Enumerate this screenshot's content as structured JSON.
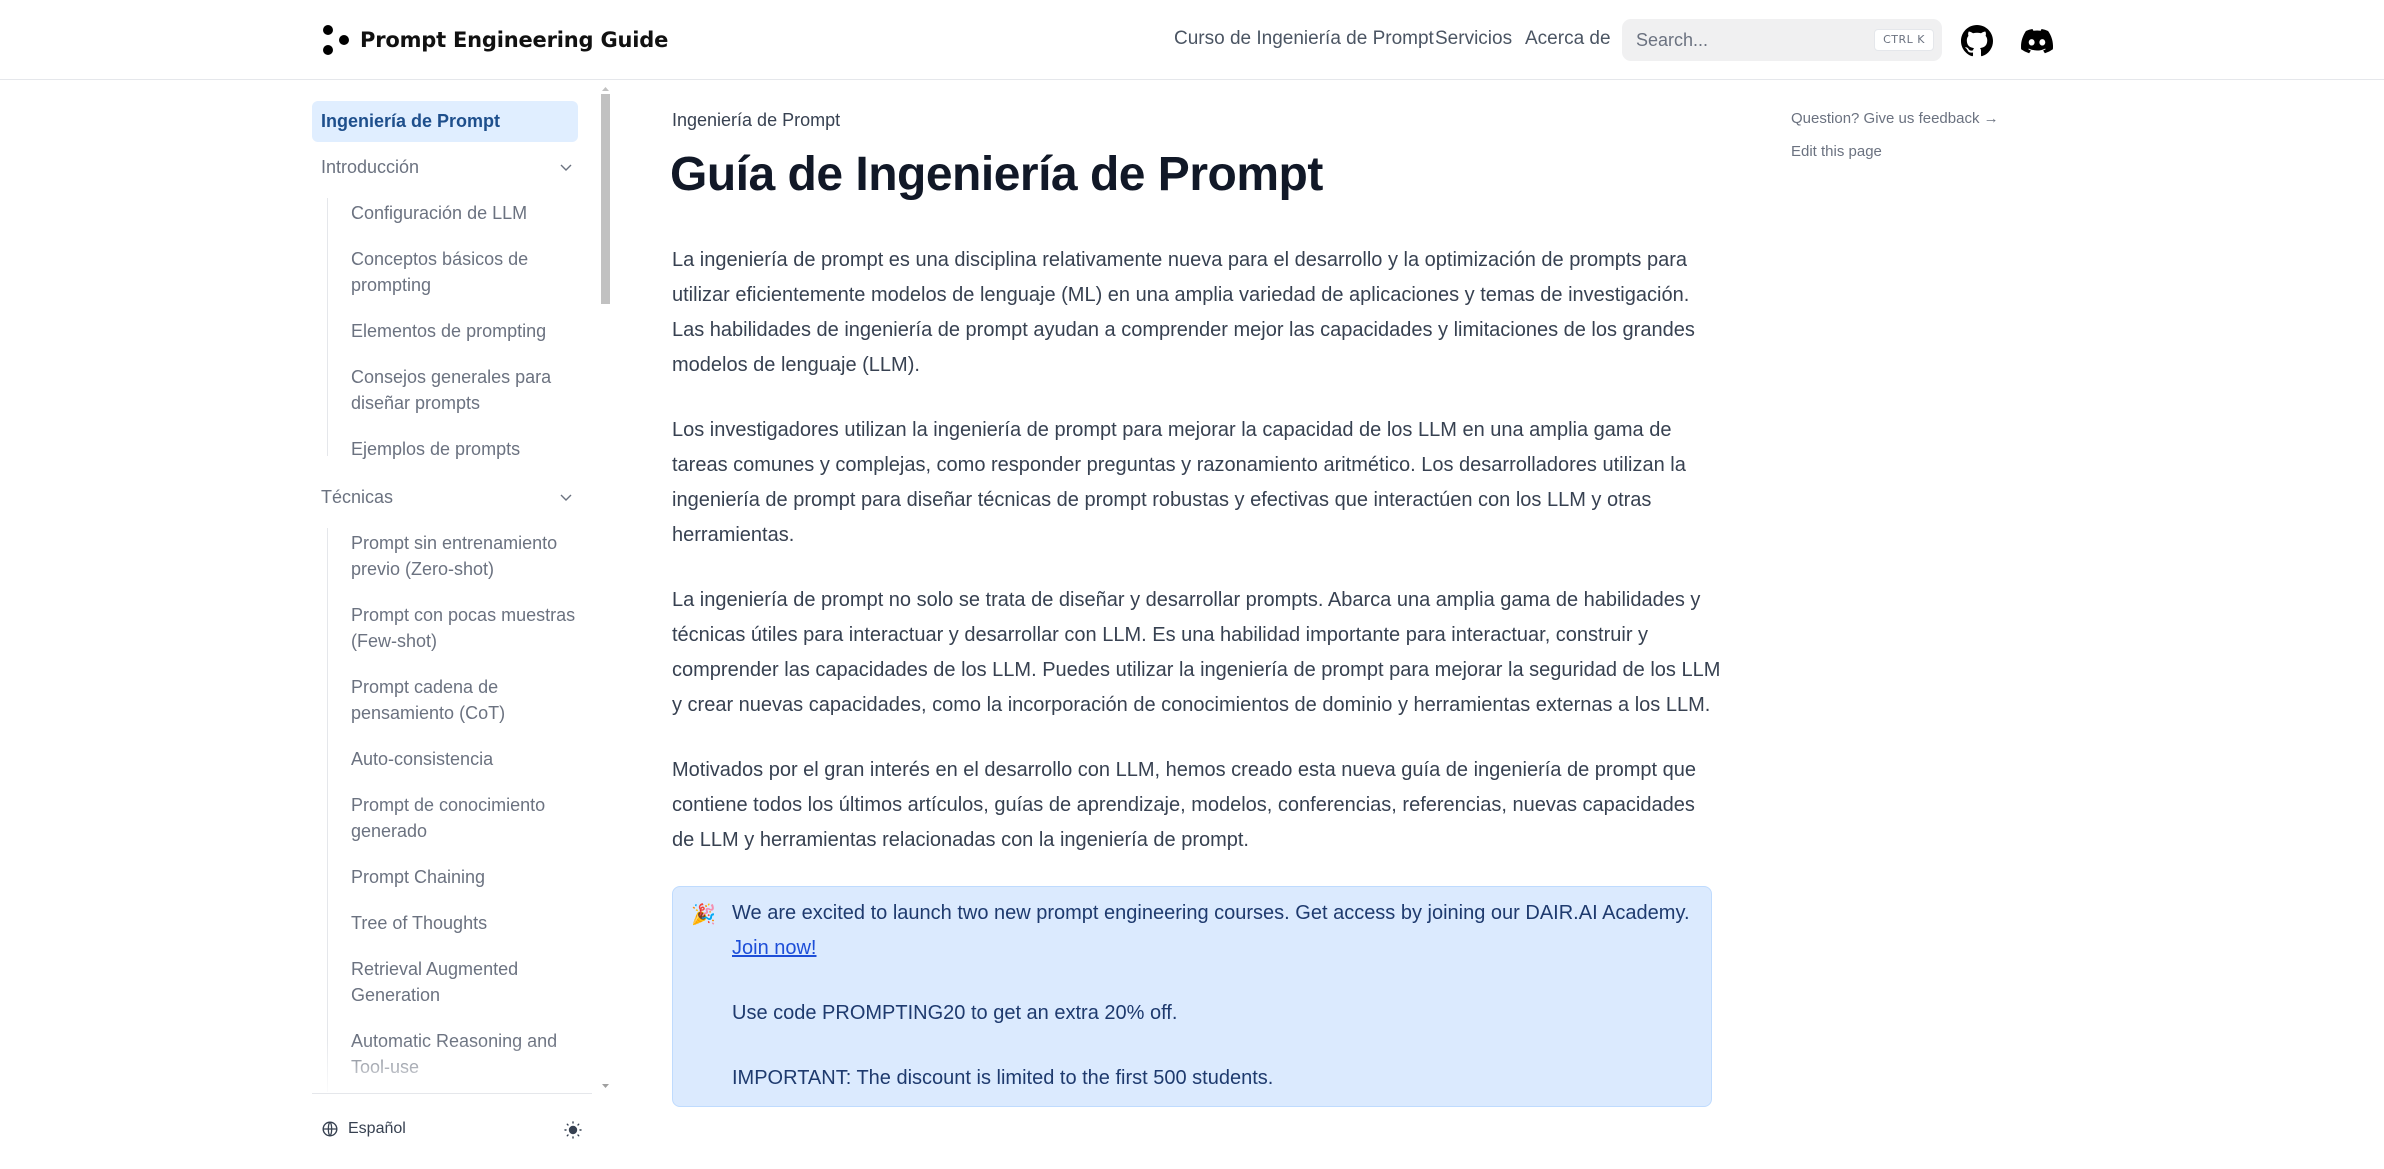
{
  "header": {
    "logo_text": "Prompt Engineering Guide",
    "nav": [
      {
        "label": "Curso de Ingeniería de Prompt"
      },
      {
        "label": "Servicios"
      },
      {
        "label": "Acerca de"
      }
    ],
    "search": {
      "placeholder": "Search...",
      "shortcut": "CTRL K"
    },
    "icons": [
      "github-icon",
      "discord-icon"
    ]
  },
  "sidebar": {
    "active_item": "Ingeniería de Prompt",
    "sections": [
      {
        "label": "Introducción",
        "expanded": true,
        "items": [
          "Configuración de LLM",
          "Conceptos básicos de prompting",
          "Elementos de prompting",
          "Consejos generales para diseñar prompts",
          "Ejemplos de prompts"
        ]
      },
      {
        "label": "Técnicas",
        "expanded": true,
        "items": [
          "Prompt sin entrenamiento previo (Zero-shot)",
          "Prompt con pocas muestras (Few-shot)",
          "Prompt cadena de pensamiento (CoT)",
          "Auto-consistencia",
          "Prompt de conocimiento generado",
          "Prompt Chaining",
          "Tree of Thoughts",
          "Retrieval Augmented Generation",
          "Automatic Reasoning and Tool-use"
        ]
      }
    ],
    "footer": {
      "language": "Español",
      "theme_icon": "sun-icon"
    }
  },
  "main": {
    "breadcrumb": "Ingeniería de Prompt",
    "title": "Guía de Ingeniería de Prompt",
    "paragraphs": [
      "La ingeniería de prompt es una disciplina relativamente nueva para el desarrollo y la optimización de prompts para utilizar eficientemente modelos de lenguaje (ML) en una amplia variedad de aplicaciones y temas de investigación. Las habilidades de ingeniería de prompt ayudan a comprender mejor las capacidades y limitaciones de los grandes modelos de lenguaje (LLM).",
      "Los investigadores utilizan la ingeniería de prompt para mejorar la capacidad de los LLM en una amplia gama de tareas comunes y complejas, como responder preguntas y razonamiento aritmético. Los desarrolladores utilizan la ingeniería de prompt para diseñar técnicas de prompt robustas y efectivas que interactúen con los LLM y otras herramientas.",
      "La ingeniería de prompt no solo se trata de diseñar y desarrollar prompts. Abarca una amplia gama de habilidades y técnicas útiles para interactuar y desarrollar con LLM. Es una habilidad importante para interactuar, construir y comprender las capacidades de los LLM. Puedes utilizar la ingeniería de prompt para mejorar la seguridad de los LLM y crear nuevas capacidades, como la incorporación de conocimientos de dominio y herramientas externas a los LLM.",
      "Motivados por el gran interés en el desarrollo con LLM, hemos creado esta nueva guía de ingeniería de prompt que contiene todos los últimos artículos, guías de aprendizaje, modelos, conferencias, referencias, nuevas capacidades de LLM y herramientas relacionadas con la ingeniería de prompt."
    ],
    "callout": {
      "emoji": "🎉",
      "line1": "We are excited to launch two new prompt engineering courses. Get access by joining our DAIR.AI Academy.",
      "link": "Join now!",
      "line2": "Use code PROMPTING20 to get an extra 20% off.",
      "line3": "IMPORTANT: The discount is limited to the first 500 students."
    }
  },
  "toc": {
    "feedback": "Question? Give us feedback →",
    "edit": "Edit this page"
  },
  "colors": {
    "active_bg": "#e0eeff",
    "active_text": "#1e4f8c",
    "callout_bg": "#dbeafe",
    "callout_text": "#1e3a6e",
    "link": "#1d4ed8"
  }
}
